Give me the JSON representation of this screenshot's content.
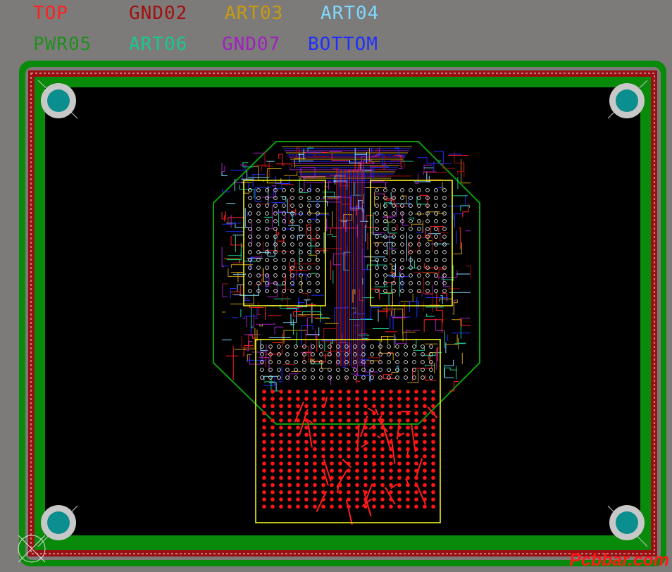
{
  "layers": [
    {
      "label": "TOP",
      "color": "#ff2020"
    },
    {
      "label": "GND02",
      "color": "#a01010"
    },
    {
      "label": "ART03",
      "color": "#c89a10"
    },
    {
      "label": "ART04",
      "color": "#7fd8ff"
    },
    {
      "label": "PWR05",
      "color": "#1f8f1f"
    },
    {
      "label": "ART06",
      "color": "#19c890"
    },
    {
      "label": "GND07",
      "color": "#a020c0"
    },
    {
      "label": "BOTTOM",
      "color": "#1f2fff"
    }
  ],
  "colors": {
    "background": "#7d7b79",
    "board": "#000000",
    "outline_green": "#0a8a0a",
    "outline_red": "#9a0f12",
    "mounting_hole_ring": "#c8c8c8",
    "mounting_hole_fill": "#0a8e8e",
    "silkscreen": "#ffff20",
    "pad": "#ff1515"
  },
  "icons": {
    "mounting_hole": "mounting-hole-icon",
    "origin_marker": "origin-crosshair-icon"
  },
  "watermark": "Pcbbar.com"
}
